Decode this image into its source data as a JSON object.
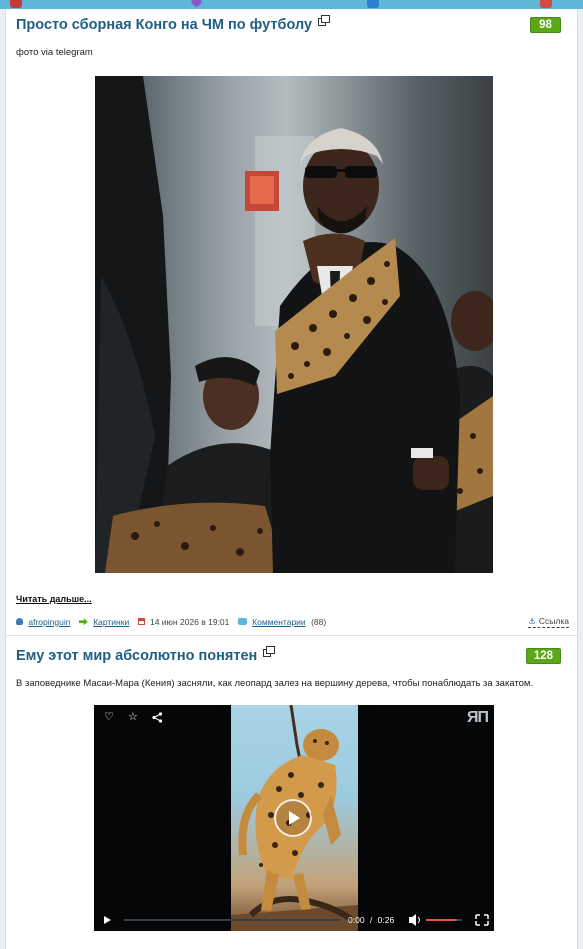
{
  "colors": {
    "title": "#1f5f86",
    "score_bg": "#5aa816",
    "topbar": "#5fb7d8",
    "volume_fill": "#e0524b"
  },
  "posts": [
    {
      "title": "Просто сборная Конго на ЧМ по футболу",
      "score": "98",
      "text": "фото via telegram",
      "image_alt": "Футболист сборной Конго в костюме с леопардовым принтом",
      "read_more": "Читать дальше...",
      "meta": {
        "author": "afropinguin",
        "category": "Картинки",
        "date": "14 июн 2026 в 19:01",
        "comments_label": "Комментарии",
        "comments_count": "(88)",
        "link_label": "Ссылка"
      }
    },
    {
      "title": "Ему этот мир абсолютно понятен",
      "score": "128",
      "text": "В заповеднике Масаи-Мара (Кения) засняли, как леопард залез на вершину дерева, чтобы понаблюдать за закатом.",
      "video": {
        "current_time": "0:00",
        "separator": "/",
        "duration": "0:26",
        "watermark": "ЯП",
        "progress": 0,
        "volume": 0.85
      }
    }
  ]
}
